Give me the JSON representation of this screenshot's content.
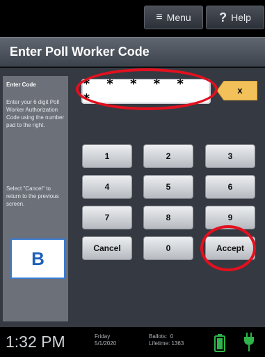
{
  "topbar": {
    "menu_label": "Menu",
    "menu_icon": "hamburger-icon",
    "help_label": "Help",
    "help_icon": "question-mark-icon"
  },
  "title": "Enter Poll Worker Code",
  "sidebar": {
    "heading": "Enter Code",
    "instructions": "Enter your 6 digit Poll Worker Authorization Code using the number pad to the right.",
    "cancel_note": "Select \"Cancel\" to return to the previous screen."
  },
  "code_field": {
    "value": "* * * * * *"
  },
  "clear_button": {
    "label": "x"
  },
  "keypad": {
    "keys": [
      "1",
      "2",
      "3",
      "4",
      "5",
      "6",
      "7",
      "8",
      "9"
    ],
    "cancel": "Cancel",
    "zero": "0",
    "accept": "Accept"
  },
  "annotation": {
    "label": "B",
    "marker_color": "#e3101f",
    "label_color": "#1c5fb8"
  },
  "status": {
    "time": "1:32 PM",
    "day": "Friday",
    "date": "5/1/2020",
    "ballots_label": "Ballots:",
    "ballots_value": "0",
    "lifetime_label": "Lifetime:",
    "lifetime_value": "1363",
    "battery_icon": "battery-full-icon",
    "power_icon": "plug-icon",
    "status_color": "#2fb34a"
  },
  "colors": {
    "accent": "#f2c15a",
    "panel": "#353a42",
    "sidebar": "#6b7079"
  }
}
